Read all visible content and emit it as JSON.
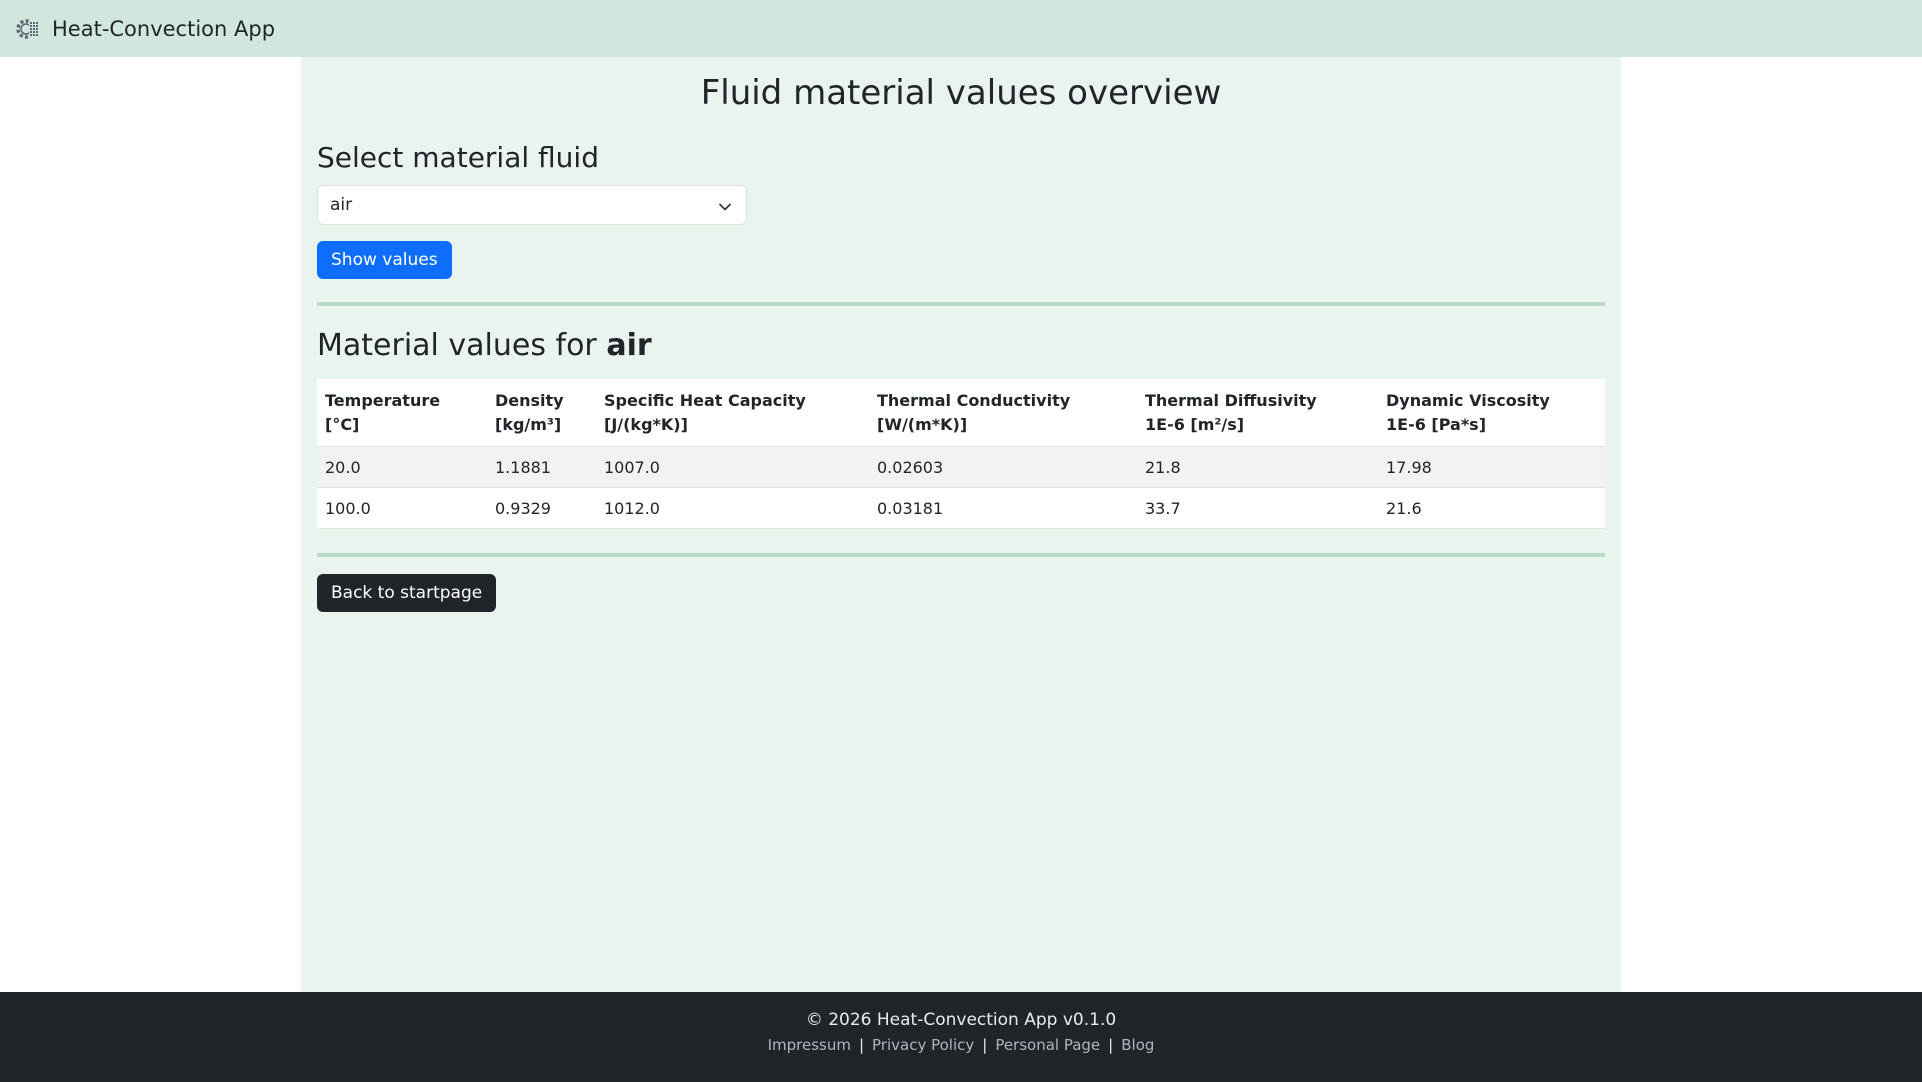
{
  "navbar": {
    "brand_icon": "gear-icon",
    "brand_text": "Heat-Convection App"
  },
  "main": {
    "page_title": "Fluid material values overview",
    "select_section_title": "Select material fluid",
    "select": {
      "selected": "air",
      "icon": "chevron-down-icon"
    },
    "show_button_label": "Show values",
    "material_values_prefix": "Material values for",
    "material_name": "air",
    "table": {
      "headers": [
        {
          "name": "Temperature",
          "unit": "[°C]"
        },
        {
          "name": "Density",
          "unit": "[kg/m³]"
        },
        {
          "name": "Specific Heat Capacity",
          "unit": "[J/(kg*K)]"
        },
        {
          "name": "Thermal Conductivity",
          "unit": "[W/(m*K)]"
        },
        {
          "name": "Thermal Diffusivity",
          "unit": "1E-6 [m²/s]"
        },
        {
          "name": "Dynamic Viscosity",
          "unit": "1E-6 [Pa*s]"
        }
      ],
      "rows": [
        [
          "20.0",
          "1.1881",
          "1007.0",
          "0.02603",
          "21.8",
          "17.98"
        ],
        [
          "100.0",
          "0.9329",
          "1012.0",
          "0.03181",
          "33.7",
          "21.6"
        ]
      ]
    },
    "back_button_label": "Back to startpage"
  },
  "footer": {
    "copyright": "© 2026 Heat-Convection App v0.1.0",
    "links": [
      "Impressum",
      "Privacy Policy",
      "Personal Page",
      "Blog"
    ],
    "separator": "|"
  },
  "colors": {
    "navbar_bg": "#d1e7dd",
    "main_bg": "#eaf4ef",
    "primary": "#0d6efd",
    "dark": "#212529",
    "divider": "#b7dbc9"
  }
}
